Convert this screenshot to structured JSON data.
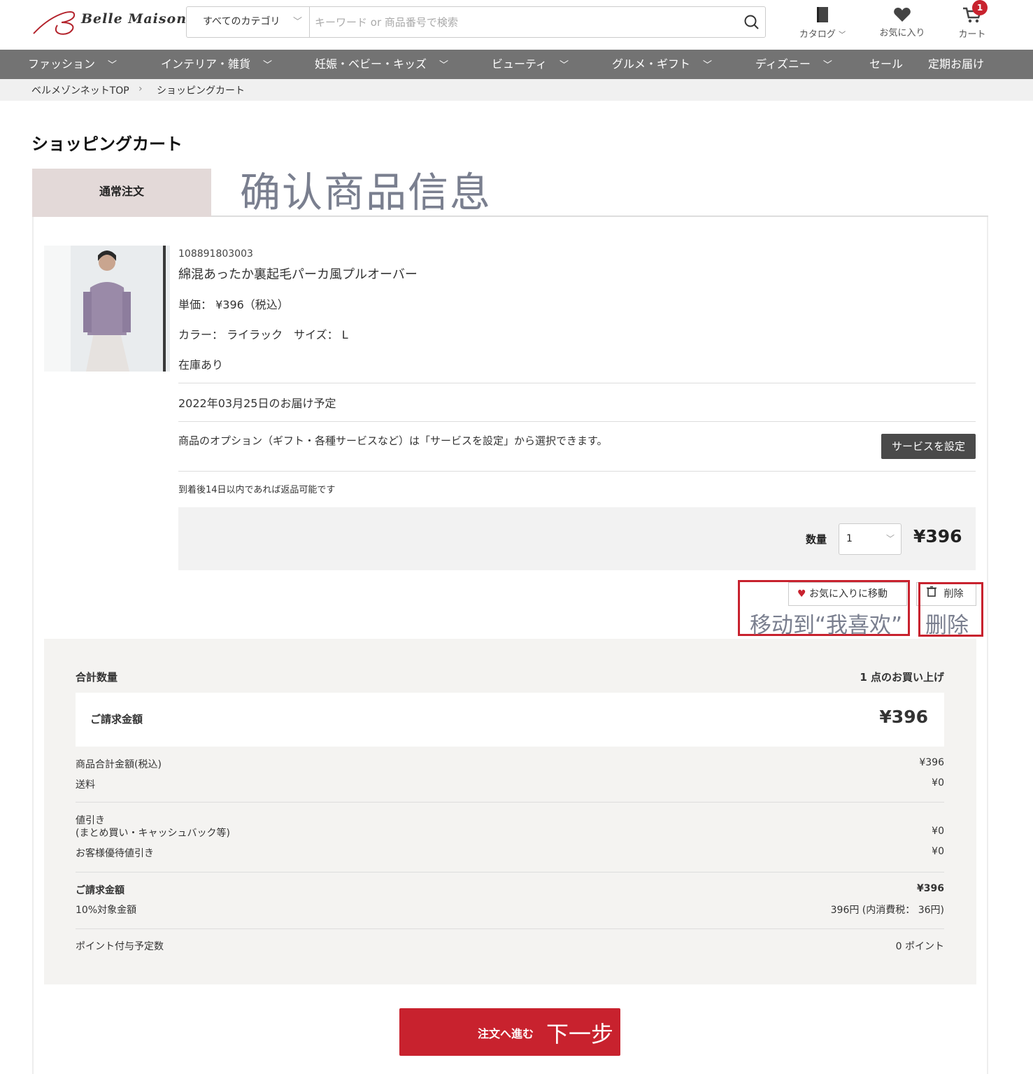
{
  "header": {
    "logo_text": "Belle Maison",
    "search": {
      "category": "すべてのカテゴリ",
      "placeholder": "キーワード or 商品番号で検索"
    },
    "icons": [
      {
        "label": "カタログ",
        "icon": "catalog-icon"
      },
      {
        "label": "お気に入り",
        "icon": "heart-icon"
      },
      {
        "label": "カート",
        "icon": "cart-icon"
      }
    ],
    "cart_badge": "1"
  },
  "nav": [
    {
      "label": "ファッション",
      "has_menu": true
    },
    {
      "label": "インテリア・雑貨",
      "has_menu": true
    },
    {
      "label": "妊娠・ベビー・キッズ",
      "has_menu": true
    },
    {
      "label": "ビューティ",
      "has_menu": true
    },
    {
      "label": "グルメ・ギフト",
      "has_menu": true
    },
    {
      "label": "ディズニー",
      "has_menu": true
    },
    {
      "label": "セール",
      "has_menu": false
    },
    {
      "label": "定期お届け",
      "has_menu": false
    }
  ],
  "breadcrumb": [
    "ベルメゾンネットTOP",
    "ショッピングカート"
  ],
  "page_title": "ショッピングカート",
  "tab_label": "通常注文",
  "annotations": {
    "confirm": "确认商品信息",
    "move_fav": "移动到“我喜欢”",
    "delete": "删除",
    "next": "下一步"
  },
  "product": {
    "code": "108891803003",
    "name": "綿混あったか裏起毛パーカ風プルオーバー",
    "unit_price": "単価： ¥396（税込）",
    "variant": "カラー： ライラック　サイズ： L",
    "stock": "在庫あり",
    "delivery": "2022年03月25日のお届け予定",
    "option_note": "商品のオプション（ギフト・各種サービスなど）は「サービスを設定」から選択できます。",
    "service_button": "サービスを設定",
    "return_note": "到着後14日以内であれば返品可能です",
    "qty_label": "数量",
    "qty_value": "1",
    "line_price": "¥396",
    "fav_button": "お気に入りに移動",
    "delete_button": "削除"
  },
  "summary": {
    "total_qty_label": "合計数量",
    "total_qty_value": "1 点のお買い上げ",
    "billing_label": "ご請求金額",
    "billing_value": "¥396",
    "subtotal_label": "商品合計金額(税込)",
    "subtotal_value": "¥396",
    "shipping_label": "送料",
    "shipping_value": "¥0",
    "discount_label_1": "値引き",
    "discount_label_2": "(まとめ買い・キャッシュバック等)",
    "discount_value": "¥0",
    "customer_discount_label": "お客様優待値引き",
    "customer_discount_value": "¥0",
    "billing2_label": "ご請求金額",
    "billing2_value": "¥396",
    "tax_label": "10%対象金額",
    "tax_value": "396円 (内消費税： 36円)",
    "points_label": "ポイント付与予定数",
    "points_value": "0 ポイント"
  },
  "next_button": "注文へ進む"
}
